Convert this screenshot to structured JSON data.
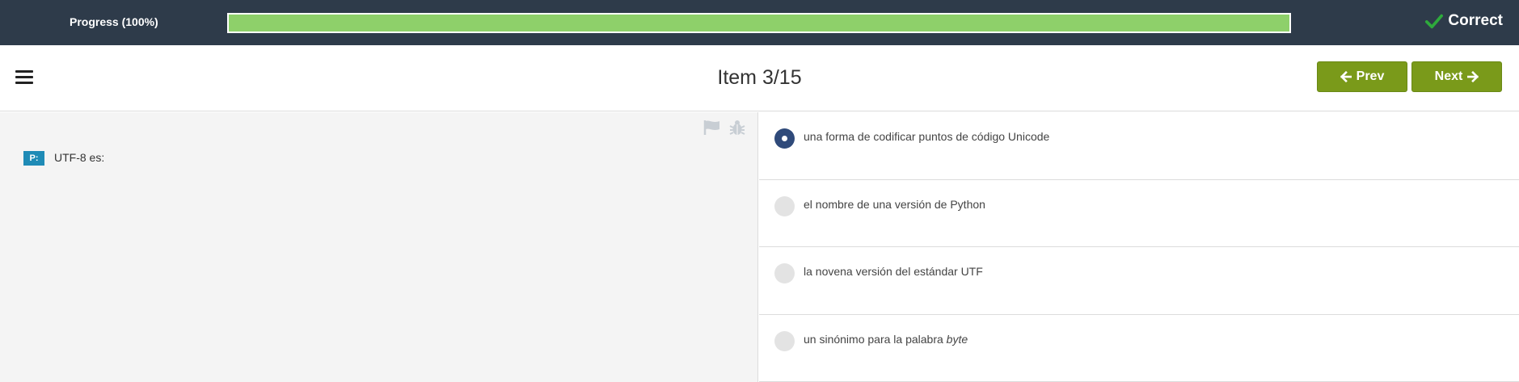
{
  "progress": {
    "label": "Progress (100%)",
    "percent": 100,
    "fill_color": "#8ed06a"
  },
  "status": {
    "text": "Correct",
    "icon": "checkmark-icon",
    "icon_color": "#2eaa3c"
  },
  "header": {
    "menu_icon": "hamburger-menu-icon",
    "item_title": "Item 3/15",
    "prev_label": "Prev",
    "next_label": "Next",
    "button_color": "#7a9a1a"
  },
  "question": {
    "badge": "P:",
    "text": "UTF-8 es:",
    "tools": [
      "flag-icon",
      "bug-icon"
    ]
  },
  "options": [
    {
      "text": "una forma de codificar puntos de código Unicode",
      "emphasis": "",
      "selected": true
    },
    {
      "text": "el nombre de una versión de Python",
      "emphasis": "",
      "selected": false
    },
    {
      "text": "la novena versión del estándar UTF",
      "emphasis": "",
      "selected": false
    },
    {
      "text": "un sinónimo para la palabra ",
      "emphasis": "byte",
      "selected": false
    }
  ]
}
